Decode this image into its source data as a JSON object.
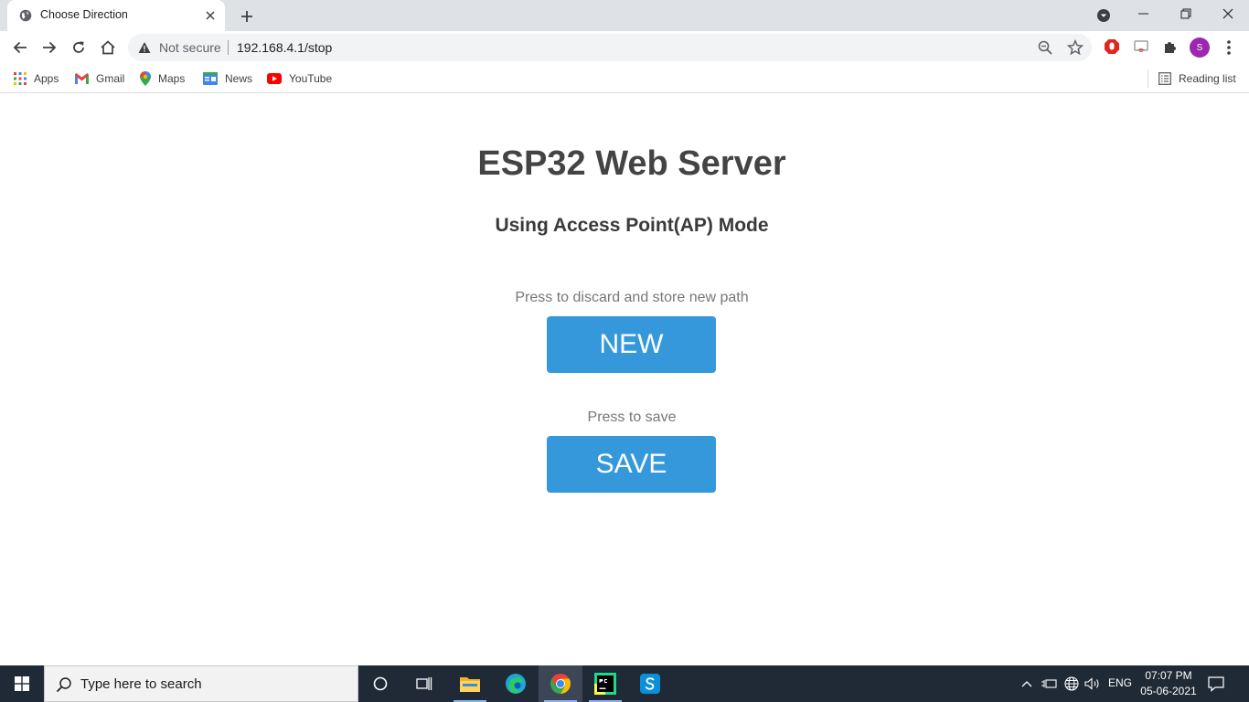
{
  "tab": {
    "title": "Choose Direction"
  },
  "omnibox": {
    "security_label": "Not secure",
    "url": "192.168.4.1/stop"
  },
  "bookmarks": {
    "items": [
      {
        "label": "Apps",
        "icon": "apps-grid-icon"
      },
      {
        "label": "Gmail",
        "icon": "gmail-icon"
      },
      {
        "label": "Maps",
        "icon": "maps-icon"
      },
      {
        "label": "News",
        "icon": "news-icon"
      },
      {
        "label": "YouTube",
        "icon": "youtube-icon"
      }
    ],
    "reading_list": "Reading list"
  },
  "profile": {
    "initial": "S",
    "color": "#9c27b0"
  },
  "page": {
    "title": "ESP32 Web Server",
    "subtitle": "Using Access Point(AP) Mode",
    "new_hint": "Press to discard and store new path",
    "new_label": "NEW",
    "save_hint": "Press to save",
    "save_label": "SAVE",
    "button_color": "#3498db"
  },
  "taskbar": {
    "search_placeholder": "Type here to search",
    "language": "ENG",
    "time": "07:07 PM",
    "date": "05-06-2021"
  }
}
